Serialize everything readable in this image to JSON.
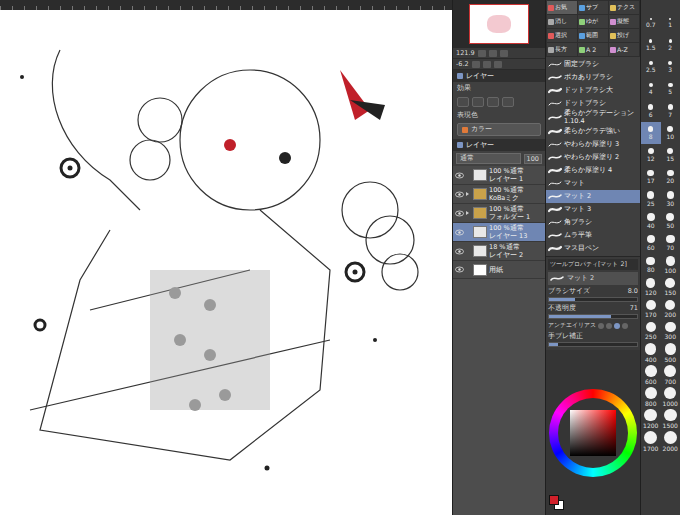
{
  "navigator": {
    "zoom": "121.9",
    "angle": "-6.2"
  },
  "tool_tabs": [
    {
      "label": "お気",
      "selected": true
    },
    {
      "label": "サブ",
      "selected": false
    },
    {
      "label": "テクス",
      "selected": false
    },
    {
      "label": "消し",
      "selected": false
    },
    {
      "label": "ゆが",
      "selected": false
    },
    {
      "label": "擬態",
      "selected": false
    },
    {
      "label": "選択",
      "selected": false
    },
    {
      "label": "範囲",
      "selected": false
    },
    {
      "label": "投げ",
      "selected": false
    },
    {
      "label": "長方",
      "selected": false
    },
    {
      "label": "A 2",
      "selected": false
    },
    {
      "label": "A-Z",
      "selected": false
    }
  ],
  "layer_property": {
    "tab": "レイヤー",
    "effect_label": "効果",
    "color_label": "表現色",
    "color_value": "カラー"
  },
  "layer_panel": {
    "tab": "レイヤー",
    "blend": "通常",
    "opacity": "100",
    "layers": [
      {
        "mode": "100 %通常",
        "name": "レイヤー 1",
        "kind": "layer",
        "visible": true,
        "selected": false
      },
      {
        "mode": "100 %通常",
        "name": "KoBaミク",
        "kind": "folder",
        "visible": true,
        "selected": false
      },
      {
        "mode": "100 %通常",
        "name": "フォルダー 1",
        "kind": "folder",
        "visible": true,
        "selected": false
      },
      {
        "mode": "100 %通常",
        "name": "レイヤー 13",
        "kind": "layer",
        "visible": true,
        "selected": true
      },
      {
        "mode": "18 %通常",
        "name": "レイヤー 2",
        "kind": "layer",
        "visible": true,
        "selected": false
      },
      {
        "name": "用紙",
        "kind": "paper",
        "visible": true,
        "selected": false
      }
    ]
  },
  "brushes": [
    {
      "name": "固定ブラシ",
      "selected": false
    },
    {
      "name": "ボカありブラシ",
      "selected": false
    },
    {
      "name": "ドットブラシ大",
      "selected": false
    },
    {
      "name": "ドットブラシ",
      "selected": false
    },
    {
      "name": "柔らかグラデーション 1.10.4",
      "selected": false
    },
    {
      "name": "柔らかグラデ強い",
      "selected": false
    },
    {
      "name": "やわらか厚塗り 3",
      "selected": false
    },
    {
      "name": "やわらか厚塗り 2",
      "selected": false
    },
    {
      "name": "柔らか厚塗り 4",
      "selected": false
    },
    {
      "name": "マット",
      "selected": false
    },
    {
      "name": "マット 2",
      "selected": true
    },
    {
      "name": "マット 3",
      "selected": false
    },
    {
      "name": "角ブラシ",
      "selected": false
    },
    {
      "name": "ムラ平筆",
      "selected": false
    },
    {
      "name": "マス目ペン",
      "selected": false
    }
  ],
  "tool_property": {
    "title": "ツールプロパティ[マット 2]",
    "brush": "マット 2",
    "sliders": [
      {
        "label": "ブラシサイズ",
        "value": "8.0",
        "level": 0.3
      },
      {
        "label": "不透明度",
        "value": "71",
        "level": 0.71
      }
    ],
    "antialias": {
      "label": "アンチエイリアス",
      "options": [
        {
          "selected": false
        },
        {
          "selected": false
        },
        {
          "selected": true
        },
        {
          "selected": false
        }
      ]
    },
    "stabilizer": {
      "label": "手ブレ補正",
      "level": 0.1
    }
  },
  "swatches": [
    {
      "color": "#d0202a",
      "selected": true
    },
    {
      "color": "#ffffff",
      "selected": false
    }
  ],
  "brush_sizes": [
    {
      "value": "0.7",
      "selected": false
    },
    {
      "value": "1",
      "selected": false
    },
    {
      "value": "1.5",
      "selected": false
    },
    {
      "value": "2",
      "selected": false
    },
    {
      "value": "2.5",
      "selected": false
    },
    {
      "value": "3",
      "selected": false
    },
    {
      "value": "4",
      "selected": false
    },
    {
      "value": "5",
      "selected": false
    },
    {
      "value": "6",
      "selected": false
    },
    {
      "value": "7",
      "selected": false
    },
    {
      "value": "8",
      "selected": true
    },
    {
      "value": "10",
      "selected": false
    },
    {
      "value": "12",
      "selected": false
    },
    {
      "value": "15",
      "selected": false
    },
    {
      "value": "17",
      "selected": false
    },
    {
      "value": "20",
      "selected": false
    },
    {
      "value": "25",
      "selected": false
    },
    {
      "value": "30",
      "selected": false
    },
    {
      "value": "40",
      "selected": false
    },
    {
      "value": "50",
      "selected": false
    },
    {
      "value": "60",
      "selected": false
    },
    {
      "value": "70",
      "selected": false
    },
    {
      "value": "80",
      "selected": false
    },
    {
      "value": "100",
      "selected": false
    },
    {
      "value": "120",
      "selected": false
    },
    {
      "value": "150",
      "selected": false
    },
    {
      "value": "170",
      "selected": false
    },
    {
      "value": "200",
      "selected": false
    },
    {
      "value": "250",
      "selected": false
    },
    {
      "value": "300",
      "selected": false
    },
    {
      "value": "400",
      "selected": false
    },
    {
      "value": "500",
      "selected": false
    },
    {
      "value": "600",
      "selected": false
    },
    {
      "value": "700",
      "selected": false
    },
    {
      "value": "800",
      "selected": false
    },
    {
      "value": "1000",
      "selected": false
    },
    {
      "value": "1200",
      "selected": false
    },
    {
      "value": "1500",
      "selected": false
    },
    {
      "value": "1700",
      "selected": false
    },
    {
      "value": "2000",
      "selected": false
    }
  ]
}
